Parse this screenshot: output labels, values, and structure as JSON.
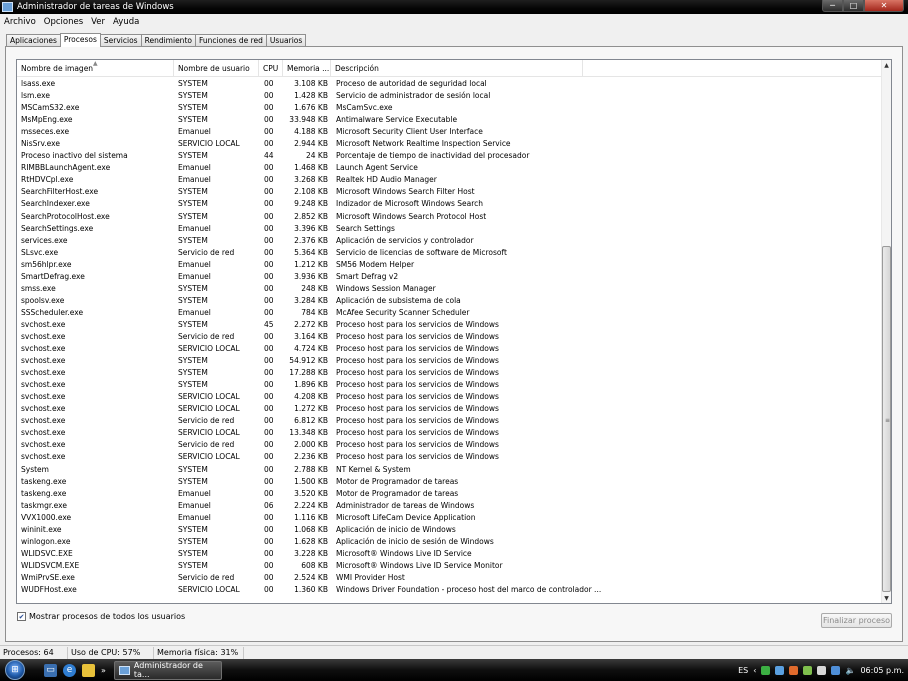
{
  "window": {
    "title": "Administrador de tareas de Windows",
    "buttons": [
      "─",
      "□",
      "✕"
    ]
  },
  "menu": [
    "Archivo",
    "Opciones",
    "Ver",
    "Ayuda"
  ],
  "tabs": [
    "Aplicaciones",
    "Procesos",
    "Servicios",
    "Rendimiento",
    "Funciones de red",
    "Usuarios"
  ],
  "active_tab": "Procesos",
  "columns": [
    "Nombre de imagen",
    "Nombre de usuario",
    "CPU",
    "Memoria ...",
    "Descripción"
  ],
  "processes": [
    [
      "lsass.exe",
      "SYSTEM",
      "00",
      "3.108 KB",
      "Proceso de autoridad de seguridad local"
    ],
    [
      "lsm.exe",
      "SYSTEM",
      "00",
      "1.428 KB",
      "Servicio de administrador de sesión local"
    ],
    [
      "MSCamS32.exe",
      "SYSTEM",
      "00",
      "1.676 KB",
      "MsCamSvc.exe"
    ],
    [
      "MsMpEng.exe",
      "SYSTEM",
      "00",
      "33.948 KB",
      "Antimalware Service Executable"
    ],
    [
      "msseces.exe",
      "Emanuel",
      "00",
      "4.188 KB",
      "Microsoft Security Client User Interface"
    ],
    [
      "NisSrv.exe",
      "SERVICIO LOCAL",
      "00",
      "2.944 KB",
      "Microsoft Network Realtime Inspection Service"
    ],
    [
      "Proceso inactivo del sistema",
      "SYSTEM",
      "44",
      "24 KB",
      "Porcentaje de tiempo de inactividad del procesador"
    ],
    [
      "RIMBBLaunchAgent.exe",
      "Emanuel",
      "00",
      "1.468 KB",
      "Launch Agent Service"
    ],
    [
      "RtHDVCpl.exe",
      "Emanuel",
      "00",
      "3.268 KB",
      "Realtek HD Audio Manager"
    ],
    [
      "SearchFilterHost.exe",
      "SYSTEM",
      "00",
      "2.108 KB",
      "Microsoft Windows Search Filter Host"
    ],
    [
      "SearchIndexer.exe",
      "SYSTEM",
      "00",
      "9.248 KB",
      "Indizador de Microsoft Windows Search"
    ],
    [
      "SearchProtocolHost.exe",
      "SYSTEM",
      "00",
      "2.852 KB",
      "Microsoft Windows Search Protocol Host"
    ],
    [
      "SearchSettings.exe",
      "Emanuel",
      "00",
      "3.396 KB",
      "Search Settings"
    ],
    [
      "services.exe",
      "SYSTEM",
      "00",
      "2.376 KB",
      "Aplicación de servicios y controlador"
    ],
    [
      "SLsvc.exe",
      "Servicio de red",
      "00",
      "5.364 KB",
      "Servicio de licencias de software de Microsoft"
    ],
    [
      "sm56hlpr.exe",
      "Emanuel",
      "00",
      "1.212 KB",
      "SM56 Modem Helper"
    ],
    [
      "SmartDefrag.exe",
      "Emanuel",
      "00",
      "3.936 KB",
      "Smart Defrag v2"
    ],
    [
      "smss.exe",
      "SYSTEM",
      "00",
      "248 KB",
      "Windows Session Manager"
    ],
    [
      "spoolsv.exe",
      "SYSTEM",
      "00",
      "3.284 KB",
      "Aplicación de subsistema de cola"
    ],
    [
      "SSScheduler.exe",
      "Emanuel",
      "00",
      "784 KB",
      "McAfee Security Scanner Scheduler"
    ],
    [
      "svchost.exe",
      "SYSTEM",
      "45",
      "2.272 KB",
      "Proceso host para los servicios de Windows"
    ],
    [
      "svchost.exe",
      "Servicio de red",
      "00",
      "3.164 KB",
      "Proceso host para los servicios de Windows"
    ],
    [
      "svchost.exe",
      "SERVICIO LOCAL",
      "00",
      "4.724 KB",
      "Proceso host para los servicios de Windows"
    ],
    [
      "svchost.exe",
      "SYSTEM",
      "00",
      "54.912 KB",
      "Proceso host para los servicios de Windows"
    ],
    [
      "svchost.exe",
      "SYSTEM",
      "00",
      "17.288 KB",
      "Proceso host para los servicios de Windows"
    ],
    [
      "svchost.exe",
      "SYSTEM",
      "00",
      "1.896 KB",
      "Proceso host para los servicios de Windows"
    ],
    [
      "svchost.exe",
      "SERVICIO LOCAL",
      "00",
      "4.208 KB",
      "Proceso host para los servicios de Windows"
    ],
    [
      "svchost.exe",
      "SERVICIO LOCAL",
      "00",
      "1.272 KB",
      "Proceso host para los servicios de Windows"
    ],
    [
      "svchost.exe",
      "Servicio de red",
      "00",
      "6.812 KB",
      "Proceso host para los servicios de Windows"
    ],
    [
      "svchost.exe",
      "SERVICIO LOCAL",
      "00",
      "13.348 KB",
      "Proceso host para los servicios de Windows"
    ],
    [
      "svchost.exe",
      "Servicio de red",
      "00",
      "2.000 KB",
      "Proceso host para los servicios de Windows"
    ],
    [
      "svchost.exe",
      "SERVICIO LOCAL",
      "00",
      "2.236 KB",
      "Proceso host para los servicios de Windows"
    ],
    [
      "System",
      "SYSTEM",
      "00",
      "2.788 KB",
      "NT Kernel & System"
    ],
    [
      "taskeng.exe",
      "SYSTEM",
      "00",
      "1.500 KB",
      "Motor de Programador de tareas"
    ],
    [
      "taskeng.exe",
      "Emanuel",
      "00",
      "3.520 KB",
      "Motor de Programador de tareas"
    ],
    [
      "taskmgr.exe",
      "Emanuel",
      "06",
      "2.224 KB",
      "Administrador de tareas de Windows"
    ],
    [
      "VVX1000.exe",
      "Emanuel",
      "00",
      "1.116 KB",
      "Microsoft LifeCam Device Application"
    ],
    [
      "wininit.exe",
      "SYSTEM",
      "00",
      "1.068 KB",
      "Aplicación de inicio de Windows"
    ],
    [
      "winlogon.exe",
      "SYSTEM",
      "00",
      "1.628 KB",
      "Aplicación de inicio de sesión de Windows"
    ],
    [
      "WLIDSVC.EXE",
      "SYSTEM",
      "00",
      "3.228 KB",
      "Microsoft® Windows Live ID Service"
    ],
    [
      "WLIDSVCM.EXE",
      "SYSTEM",
      "00",
      "608 KB",
      "Microsoft® Windows Live ID Service Monitor"
    ],
    [
      "WmiPrvSE.exe",
      "Servicio de red",
      "00",
      "2.524 KB",
      "WMI Provider Host"
    ],
    [
      "WUDFHost.exe",
      "SERVICIO LOCAL",
      "00",
      "1.360 KB",
      "Windows Driver Foundation - proceso host del marco de controlador ..."
    ]
  ],
  "show_all_label": "Mostrar procesos de todos los usuarios",
  "show_all_checked": true,
  "end_process_label": "Finalizar proceso",
  "status": {
    "processes": "Procesos: 64",
    "cpu": "Uso de CPU: 57%",
    "memory": "Memoria física: 31%"
  },
  "taskbar": {
    "task_button": "Administrador de ta...",
    "language": "ES",
    "clock": "06:05 p.m."
  }
}
